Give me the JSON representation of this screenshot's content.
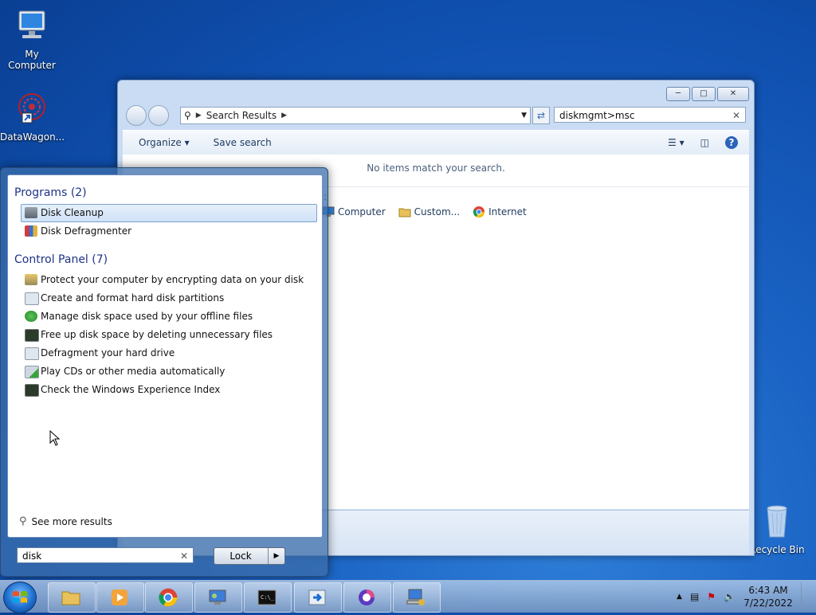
{
  "desktop": {
    "icons": [
      {
        "label": "My Computer",
        "icon": "computer-icon"
      },
      {
        "label": "DataWagon...",
        "icon": "datawagon-icon"
      },
      {
        "label": "Recycle Bin",
        "icon": "recycle-bin-icon"
      }
    ]
  },
  "explorer": {
    "address": {
      "text": "Search Results"
    },
    "search": {
      "value": "diskmgmt>msc"
    },
    "toolbar": {
      "organize": "Organize",
      "save_search": "Save search"
    },
    "no_items": "No items match your search.",
    "search_again_label": ":",
    "search_again": [
      {
        "label": "Computer",
        "icon": "computer-icon"
      },
      {
        "label": "Custom...",
        "icon": "folder-icon"
      },
      {
        "label": "Internet",
        "icon": "chrome-icon"
      }
    ]
  },
  "start_menu": {
    "programs": {
      "title": "Programs (2)",
      "items": [
        {
          "label": "Disk Cleanup",
          "icon": "disk-cleanup-icon",
          "selected": true
        },
        {
          "label": "Disk Defragmenter",
          "icon": "disk-defragmenter-icon"
        }
      ]
    },
    "control_panel": {
      "title": "Control Panel (7)",
      "items": [
        {
          "label": "Protect your computer by encrypting data on your disk",
          "icon": "bitlocker-icon"
        },
        {
          "label": "Create and format hard disk partitions",
          "icon": "partition-icon"
        },
        {
          "label": "Manage disk space used by your offline files",
          "icon": "sync-icon"
        },
        {
          "label": "Free up disk space by deleting unnecessary files",
          "icon": "monitor-icon"
        },
        {
          "label": "Defragment your hard drive",
          "icon": "defrag-icon"
        },
        {
          "label": "Play CDs or other media automatically",
          "icon": "autoplay-icon"
        },
        {
          "label": "Check the Windows Experience Index",
          "icon": "monitor-icon"
        }
      ]
    },
    "see_more": "See more results",
    "search_value": "disk",
    "lock_label": "Lock"
  },
  "taskbar": {
    "time": "6:43 AM",
    "date": "7/22/2022"
  }
}
